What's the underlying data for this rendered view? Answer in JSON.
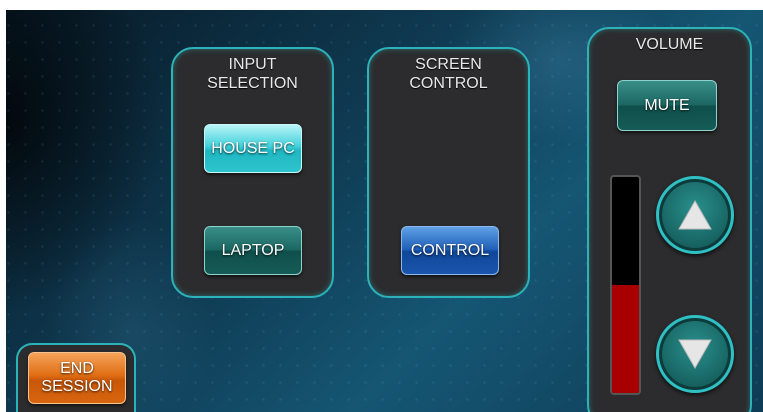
{
  "input_panel": {
    "title_line1": "INPUT",
    "title_line2": "SELECTION",
    "house_pc_label": "HOUSE PC",
    "laptop_label": "LAPTOP"
  },
  "screen_panel": {
    "title_line1": "SCREEN",
    "title_line2": "CONTROL",
    "control_label": "CONTROL"
  },
  "volume_panel": {
    "title": "VOLUME",
    "mute_label": "MUTE",
    "level_fraction": 0.5,
    "up_icon": "triangle-up-icon",
    "down_icon": "triangle-down-icon"
  },
  "end_session": {
    "line1": "END",
    "line2": "SESSION"
  },
  "colors": {
    "panel_border": "#2bb3b9",
    "panel_bg": "#2c2c2e",
    "meter_fill": "#a80000",
    "selected_input": "#43d2dc",
    "end_button": "#e06d14"
  }
}
